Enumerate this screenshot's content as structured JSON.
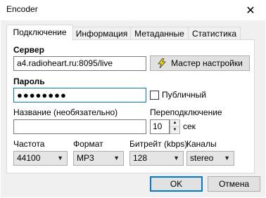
{
  "window": {
    "title": "Encoder",
    "close_glyph": "✕"
  },
  "tabs": [
    {
      "label": "Подключение",
      "active": true
    },
    {
      "label": "Информация",
      "active": false
    },
    {
      "label": "Метаданные",
      "active": false
    },
    {
      "label": "Статистика",
      "active": false
    }
  ],
  "server": {
    "label": "Сервер",
    "value": "a4.radioheart.ru:8095/live",
    "wizard_label": "Мастер настройки",
    "wizard_icon": "lightning-icon"
  },
  "password": {
    "label": "Пароль",
    "value_masked": "●●●●●●●●",
    "public_label": "Публичный",
    "public_checked": false
  },
  "name": {
    "label": "Название (необязательно)",
    "value": ""
  },
  "reconnect": {
    "label": "Переподключение",
    "value": "10",
    "unit": "сек"
  },
  "frequency": {
    "label": "Частота",
    "value": "44100"
  },
  "format": {
    "label": "Формат",
    "value": "MP3"
  },
  "bitrate": {
    "label": "Битрейт (kbps)",
    "value": "128"
  },
  "channels": {
    "label": "Каналы",
    "value": "stereo"
  },
  "buttons": {
    "ok": "OK",
    "cancel": "Отмена"
  },
  "colors": {
    "focus_border": "#0078d7",
    "dialog_bg": "#f0f0f0"
  }
}
